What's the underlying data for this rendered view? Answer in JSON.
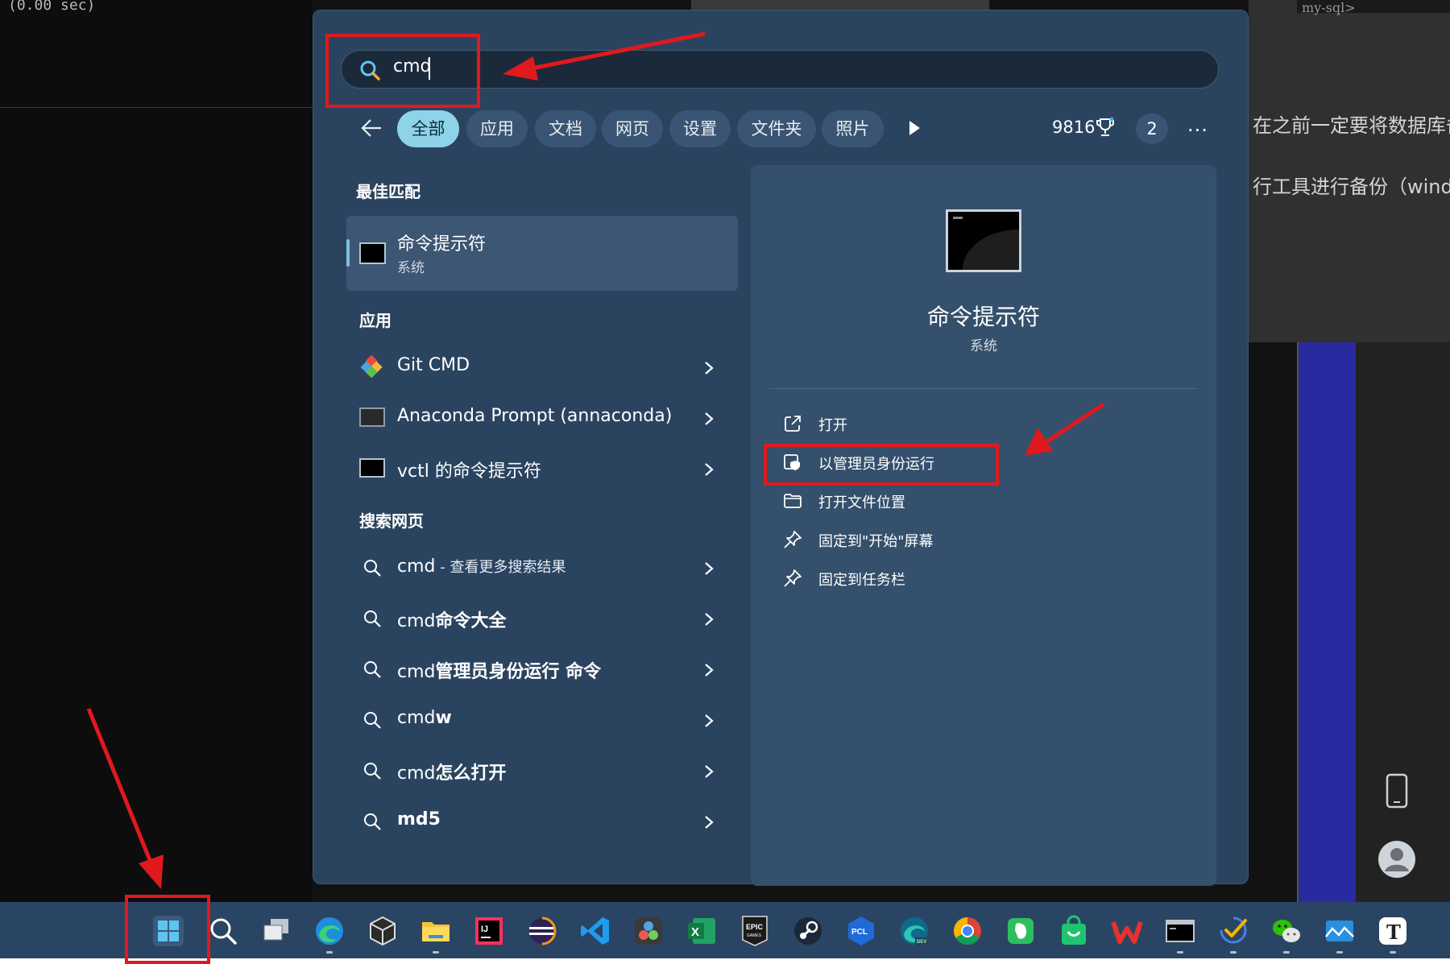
{
  "background": {
    "console_text": "(0.00 sec)",
    "top_right_text": "my-sql>",
    "doc_lines": [
      "在之前一定要将数据库备",
      "行工具进行备份（window"
    ]
  },
  "search": {
    "query": "cmd"
  },
  "filters": {
    "tabs": [
      "全部",
      "应用",
      "文档",
      "网页",
      "设置",
      "文件夹",
      "照片"
    ],
    "points": "9816",
    "badge": "2",
    "more": "···"
  },
  "best_match": {
    "section_title": "最佳匹配",
    "name": "命令提示符",
    "subtitle": "系统"
  },
  "apps": {
    "section_title": "应用",
    "items": [
      {
        "label": "Git CMD"
      },
      {
        "label": "Anaconda Prompt (annaconda)"
      },
      {
        "label": "vctl 的命令提示符"
      }
    ]
  },
  "web": {
    "section_title": "搜索网页",
    "items": [
      {
        "main": "cmd",
        "suffix": " - 查看更多搜索结果"
      },
      {
        "main": "cmd",
        "suffix": "命令大全"
      },
      {
        "main": "cmd",
        "suffix": "管理员身份运行 命令"
      },
      {
        "main": "cmd",
        "suffix": "w"
      },
      {
        "main": "cmd",
        "suffix": "怎么打开"
      },
      {
        "main": "md5",
        "suffix": ""
      }
    ]
  },
  "preview": {
    "name": "命令提示符",
    "subtitle": "系统",
    "actions": [
      "打开",
      "以管理员身份运行",
      "打开文件位置",
      "固定到\"开始\"屏幕",
      "固定到任务栏"
    ]
  },
  "colors": {
    "accent": "#8fd3e8",
    "panel": "#2a4460",
    "annotation": "#e0191f"
  },
  "taskbar": {
    "icons": [
      "start-icon",
      "search-icon",
      "task-view-icon",
      "edge-icon",
      "unity-icon",
      "file-explorer-icon",
      "intellij-icon",
      "eclipse-icon",
      "vscode-icon",
      "davinci-icon",
      "excel-icon",
      "epic-games-icon",
      "steam-icon",
      "pcl-icon",
      "edge-dev-icon",
      "chrome-icon",
      "evernote-icon",
      "shopping-bag-icon",
      "wps-icon",
      "terminal-icon",
      "todo-icon",
      "wechat-icon",
      "photos-icon",
      "typora-icon"
    ]
  }
}
